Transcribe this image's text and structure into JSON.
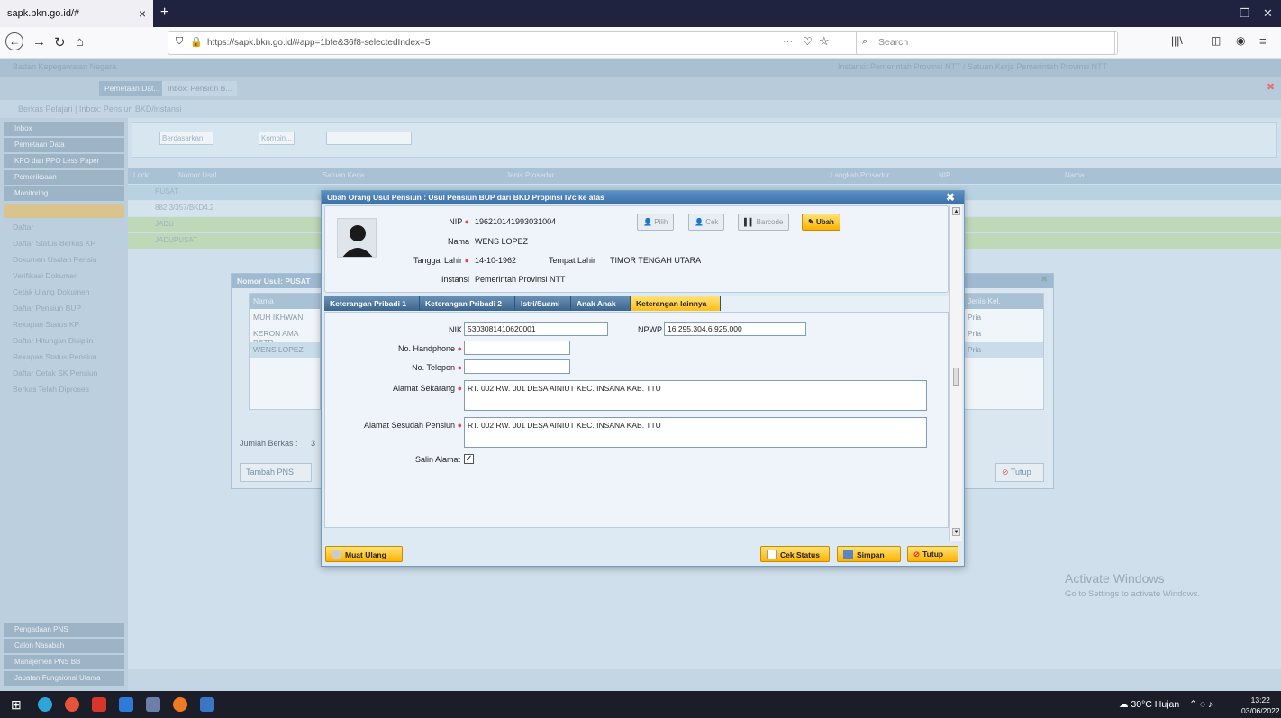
{
  "browser": {
    "tab_title": "sapk.bkn.go.id/#",
    "url": "https://sapk.bkn.go.id/#app=1bfe&36f8-selectedIndex=5",
    "search_placeholder": "Search",
    "tab_close": "×",
    "new_tab": "+",
    "more_dots": "···"
  },
  "app": {
    "header": "Badan Kepegawaian Negara",
    "header_right": "Instansi: Pemerintah Provinsi NTT / Satuan Kerja Pemerintah Provinsi NTT",
    "tabs": [
      "Pemetaan Dat...",
      "Inbox: Pension B..."
    ],
    "crumbs": "Berkas Pelajari  |  Inbox: Pensiun BKD/instansi",
    "filter_label": "Berdasarkan",
    "filter_kolom": "Kombin..."
  },
  "sidebar": {
    "heads": [
      "Inbox",
      "Pemetaan Data",
      "KPO dan PPO Less Paper",
      "Pemeriksaan",
      "Monitoring"
    ],
    "items": [
      "Daftar",
      "Daftar Status Berkas KP",
      "Dokumen Usulan Pensiu",
      "Verifikasi Dokumen",
      "Cetak Ulang Dokumen",
      "Daftar Pensiun BUP",
      "Rekapan Status KP",
      "Daftar Hitungan Disiplin",
      "Rekapan Status Pensiun",
      "Daftar Cetak SK Pensiun",
      "Berkas Telah Diproses"
    ],
    "bottom_heads": [
      "Pengadaan PNS",
      "Calon Nasabah",
      "Manajemen PNS BB",
      "Jabatan Fungsional Utama"
    ]
  },
  "grid": {
    "headers": [
      "Lock",
      "Nomor Usul",
      "Satuan Kerja",
      "Jenis Prosedur",
      "Langkah Prosedur",
      "NIP",
      "Nama"
    ],
    "rows": [
      "PUSAT",
      "882.3/357/BKD4.2",
      "JADU",
      "JADUPUSAT"
    ]
  },
  "inner_dialog": {
    "title": "Nomor Usul: PUSAT",
    "col_nama": "Nama",
    "names": [
      "MUH IKHWAN",
      "KERON AMA PETR",
      "WENS LOPEZ"
    ],
    "col_jenis": "Jenis Kel.",
    "genders": [
      "Pria",
      "Pria",
      "Pria"
    ],
    "jumlah_label": "Jumlah Berkas :",
    "jumlah_value": "3",
    "tambah_button": "Tambah PNS",
    "tutup_button": "Tutup"
  },
  "modal": {
    "title": "Ubah Orang Usul Pensiun : Usul Pensiun BUP dari BKD Propinsi IVc ke atas",
    "close": "✖",
    "nip_label": "NIP",
    "nip": "196210141993031004",
    "nama_label": "Nama",
    "nama": "WENS LOPEZ",
    "tgl_label": "Tanggal Lahir",
    "tgl_lahir": "14-10-1962",
    "tempat_label": "Tempat Lahir",
    "tempat_lahir": "TIMOR TENGAH UTARA",
    "instansi_label": "Instansi",
    "instansi": "Pemerintah Provinsi NTT",
    "top_buttons": {
      "pilih": "Pilih",
      "cek": "Cek",
      "barcode": "Barcode",
      "ubah": "Ubah"
    },
    "tabs": [
      "Keterangan Pribadi 1",
      "Keterangan Pribadi 2",
      "Istri/Suami",
      "Anak Anak",
      "Keterangan lainnya"
    ],
    "form": {
      "nik_label": "NIK",
      "nik": "5303081410620001",
      "npwp_label": "NPWP",
      "npwp": "16.295.304.6.925.000",
      "hp_label": "No. Handphone",
      "hp": "",
      "telp_label": "No. Telepon",
      "telp": "",
      "alamat_label": "Alamat Sekarang",
      "alamat": "RT. 002 RW. 001 DESA AINIUT KEC. INSANA KAB. TTU",
      "alamat_pensiun_label": "Alamat Sesudah Pensiun",
      "alamat_pensiun": "RT. 002 RW. 001 DESA AINIUT KEC. INSANA KAB. TTU",
      "salin_label": "Salin Alamat",
      "salin_checked": true
    },
    "footer": {
      "muat_ulang": "Muat Ulang",
      "cek_status": "Cek Status",
      "simpan": "Simpan",
      "tutup": "Tutup"
    }
  },
  "watermark": {
    "line1": "Activate Windows",
    "line2": "Go to Settings to activate Windows."
  },
  "taskbar": {
    "weather": "30°C Hujan",
    "time": "13:22",
    "date": "03/06/2022"
  },
  "colors": {
    "accent": "#ffb300",
    "titlebar": "#3c6fa6",
    "required": "#e04a5a"
  }
}
